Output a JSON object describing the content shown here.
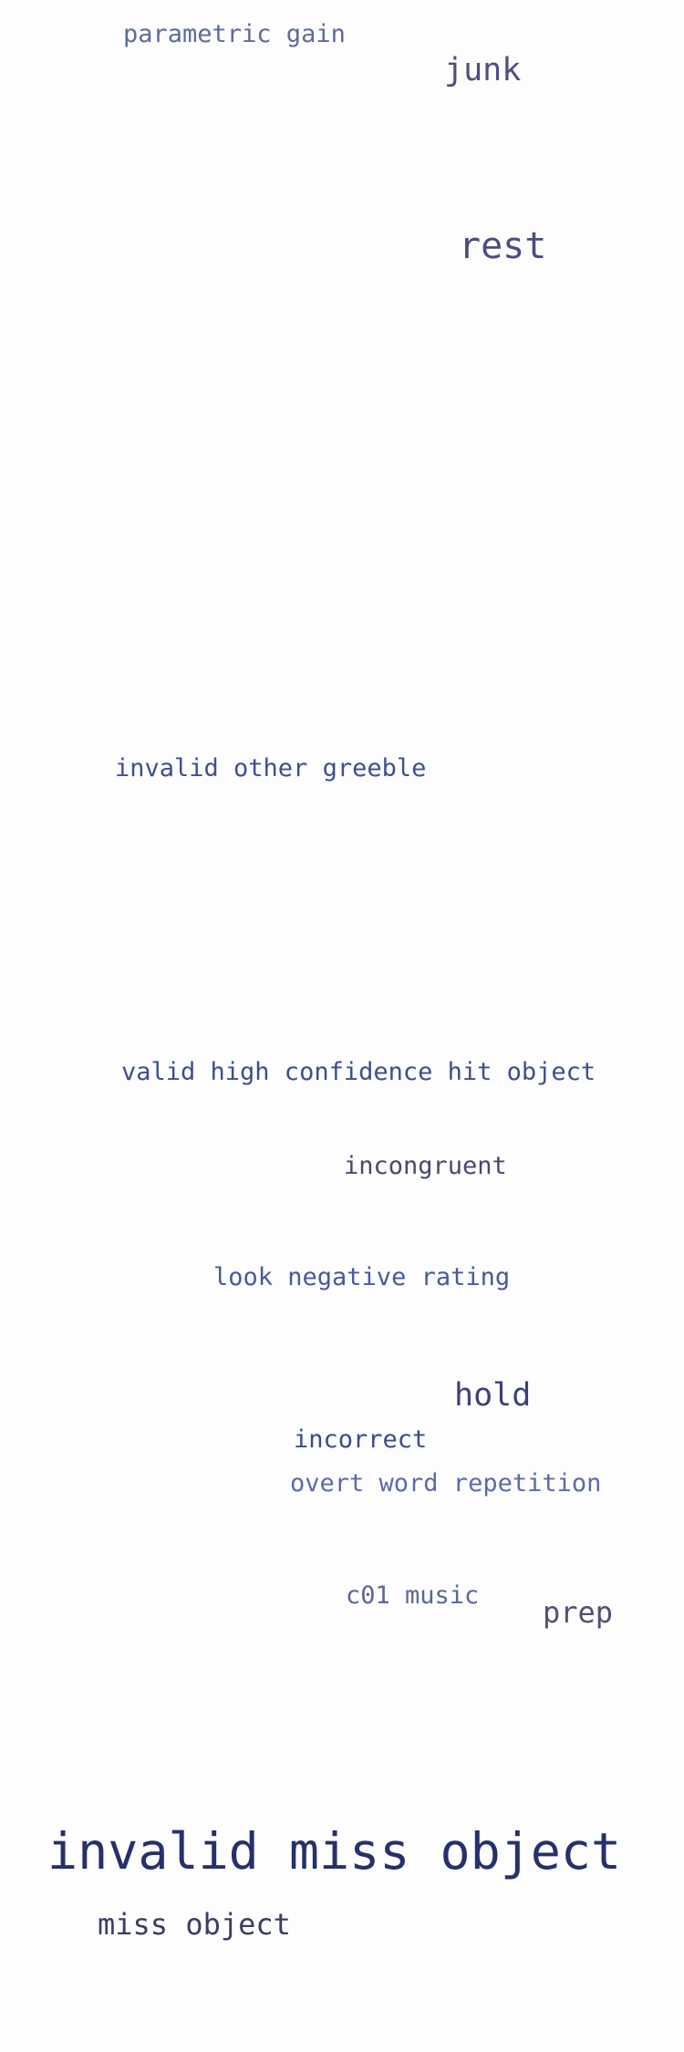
{
  "words": [
    {
      "text": "parametric gain",
      "color": "#5d6b9a"
    },
    {
      "text": "junk",
      "color": "#4e4e80"
    },
    {
      "text": "rest",
      "color": "#4a4d7c"
    },
    {
      "text": "invalid other greeble",
      "color": "#3f4f8f"
    },
    {
      "text": "valid high confidence hit object",
      "color": "#3d4e8e"
    },
    {
      "text": "incongruent",
      "color": "#464a6e"
    },
    {
      "text": "look negative rating",
      "color": "#4a57a0"
    },
    {
      "text": "hold",
      "color": "#3d4275"
    },
    {
      "text": "incorrect",
      "color": "#3f4a8a"
    },
    {
      "text": "overt word repetition",
      "color": "#5c6aa8"
    },
    {
      "text": "c01 music",
      "color": "#5b6699"
    },
    {
      "text": "prep",
      "color": "#505070"
    },
    {
      "text": "invalid miss object",
      "color": "#26306b"
    },
    {
      "text": "miss object",
      "color": "#3a3e63"
    }
  ]
}
